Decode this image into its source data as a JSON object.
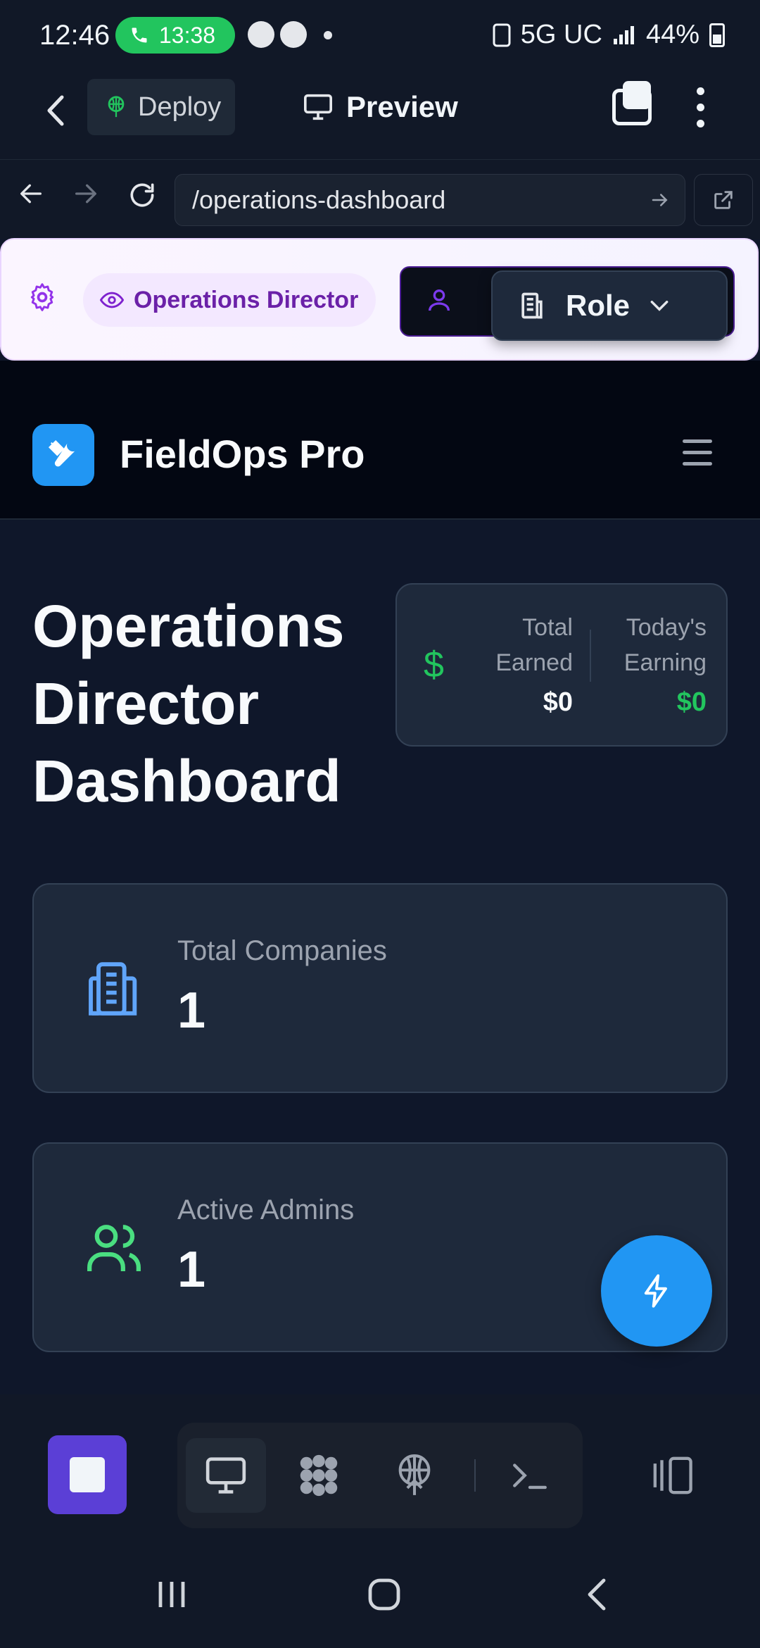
{
  "status_bar": {
    "time": "12:46",
    "call_timer": "13:38",
    "network": "5G UC",
    "battery": "44%"
  },
  "app_bar": {
    "deploy_label": "Deploy",
    "preview_label": "Preview"
  },
  "url_bar": {
    "url": "/operations-dashboard"
  },
  "role_bar": {
    "current_role": "Operations Director",
    "role_select_label": "Role"
  },
  "app_header": {
    "title": "FieldOps Pro"
  },
  "dashboard": {
    "title": "Operations Director Dashboard",
    "earnings": {
      "total_label": "Total Earned",
      "total_value": "$0",
      "today_label": "Today's Earning",
      "today_value": "$0"
    },
    "stats": [
      {
        "label": "Total Companies",
        "value": "1",
        "icon": "building-icon"
      },
      {
        "label": "Active Admins",
        "value": "1",
        "icon": "users-icon"
      }
    ]
  },
  "colors": {
    "accent_blue": "#2196f3",
    "accent_purple": "#6b21a8",
    "success_green": "#22c55e",
    "background": "#0f172a"
  }
}
